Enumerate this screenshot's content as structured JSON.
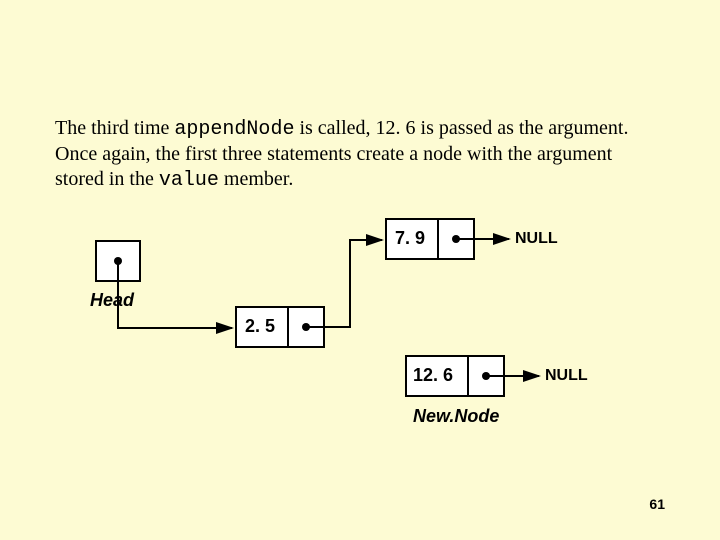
{
  "paragraph": {
    "p1a": "The third time ",
    "code1": "appendNode",
    "p1b": " is called, 12. 6 is passed as the argument. Once again, the first three statements create a node with the argument stored in the ",
    "code2": "value",
    "p1c": " member."
  },
  "nodes": {
    "n2_5": "2. 5",
    "n7_9": "7. 9",
    "n12_6": "12. 6",
    "null1": "NULL",
    "null2": "NULL"
  },
  "labels": {
    "head": "Head",
    "newnode": "New.Node"
  },
  "page_number": "61"
}
